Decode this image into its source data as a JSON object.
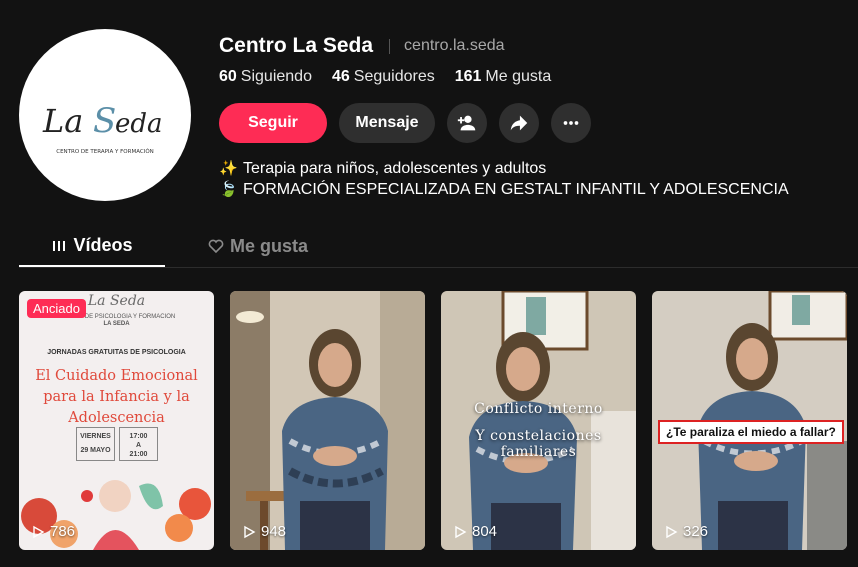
{
  "profile": {
    "display_name": "Centro La Seda",
    "username": "centro.la.seda",
    "avatar_logo_text": "LaSeda",
    "avatar_tagline": "CENTRO DE TERAPIA Y FORMACIÓN"
  },
  "stats": {
    "following_count": "60",
    "following_label": "Siguiendo",
    "followers_count": "46",
    "followers_label": "Seguidores",
    "likes_count": "161",
    "likes_label": "Me gusta"
  },
  "actions": {
    "follow_label": "Seguir",
    "message_label": "Mensaje",
    "add_friend_icon": "person-add-icon",
    "share_icon": "share-icon",
    "more_icon": "more-icon"
  },
  "bio": {
    "line1_emoji": "✨",
    "line1": "Terapia para niños, adolescentes y adultos",
    "line2_emoji": "🍃",
    "line2": "FORMACIÓN ESPECIALIZADA EN GESTALT INFANTIL Y ADOLESCENCIA"
  },
  "tabs": {
    "videos_label": "Vídeos",
    "likes_label": "Me gusta"
  },
  "videos": [
    {
      "pinned_label": "Anciado",
      "views": "786",
      "poster": {
        "logo": "La Seda",
        "sub1": "CENTRO DE PSICOLOGIA Y FORMACION",
        "sub2": "LA SEDA",
        "jornadas": "JORNADAS GRATUITAS DE PSICOLOGIA",
        "title": "El Cuidado Emocional para la Infancia y la Adolescencia",
        "day": "VIERNES",
        "date": "29 MAYO",
        "time_from": "17:00",
        "time_sep": "A",
        "time_to": "21:00"
      }
    },
    {
      "views": "948"
    },
    {
      "views": "804",
      "caption_line1": "Conflicto interno",
      "caption_line2": "Y constelaciones familiares"
    },
    {
      "views": "326",
      "caption": "¿Te paraliza el miedo a fallar?"
    }
  ],
  "colors": {
    "accent": "#fe2c55",
    "background": "#121212",
    "button_dark": "#2f2f2f"
  }
}
